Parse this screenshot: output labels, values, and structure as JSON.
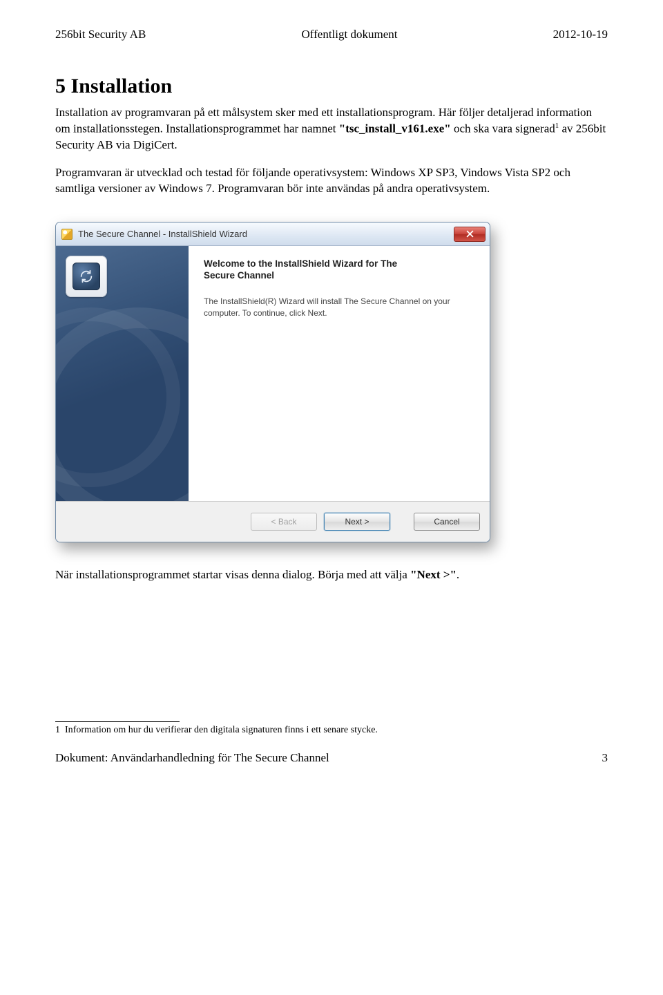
{
  "header": {
    "left": "256bit Security AB",
    "center": "Offentligt dokument",
    "right": "2012-10-19"
  },
  "section": {
    "title": "5 Installation",
    "p1_a": "Installation av programvaran på ett målsystem sker med ett installationsprogram. Här följer detaljerad information om installationsstegen. Installationsprogrammet har namnet ",
    "p1_bold": "\"tsc_install_v161.exe\"",
    "p1_b": " och ska vara signerad",
    "p1_sup": "1",
    "p1_c": " av 256bit Security AB via DigiCert.",
    "p2": "Programvaran är utvecklad och testad för följande operativsystem: Windows XP SP3, Vindows Vista SP2 och samtliga versioner av Windows 7. Programvaran bör inte användas på andra operativsystem.",
    "caption_a": "När installationsprogrammet startar visas denna dialog. Börja med att välja ",
    "caption_bold": "\"Next >\"",
    "caption_b": "."
  },
  "dialog": {
    "title": "The Secure Channel - InstallShield Wizard",
    "welcome_l1": "Welcome to the InstallShield Wizard for The",
    "welcome_l2": "Secure Channel",
    "body": "The InstallShield(R) Wizard will install The Secure Channel on your computer. To continue, click Next.",
    "btn_back": "< Back",
    "btn_next": "Next >",
    "btn_cancel": "Cancel"
  },
  "footnote": {
    "num": "1",
    "text": "Information om hur du verifierar den digitala signaturen finns i ett senare stycke."
  },
  "footer": {
    "left": "Dokument: Användarhandledning för The Secure Channel",
    "right": "3"
  }
}
